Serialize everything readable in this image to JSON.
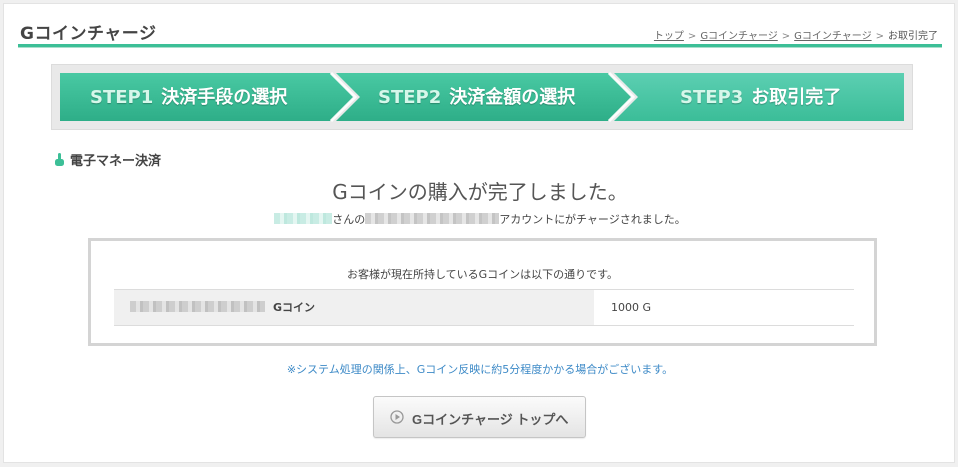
{
  "header": {
    "title": "Gコインチャージ",
    "breadcrumb": [
      {
        "label": "トップ",
        "link": true
      },
      {
        "label": "Gコインチャージ",
        "link": true
      },
      {
        "label": "Gコインチャージ",
        "link": true
      },
      {
        "label": "お取引完了",
        "link": false
      }
    ],
    "breadcrumb_separator": ">"
  },
  "steps": [
    {
      "num": "STEP1",
      "label": "決済手段の選択"
    },
    {
      "num": "STEP2",
      "label": "決済金額の選択"
    },
    {
      "num": "STEP3",
      "label": "お取引完了"
    }
  ],
  "section": {
    "heading": "電子マネー決済"
  },
  "result": {
    "title": "Gコインの購入が完了しました。",
    "account_suffix_1": "さんの",
    "account_suffix_2": "アカウントにがチャージされました。"
  },
  "balance": {
    "caption": "お客様が現在所持しているGコインは以下の通りです。",
    "row_label": "Gコイン",
    "row_value": "1000 G"
  },
  "notice": "※システム処理の関係上、Gコイン反映に約5分程度かかる場合がございます。",
  "button": {
    "label": "Gコインチャージ トップへ"
  },
  "colors": {
    "accent": "#3cbf97",
    "step_dark": "#2fb08a",
    "step_light": "#6ad7bd",
    "notice": "#3d8ac7"
  },
  "icons": {
    "section": "finger-pointer-icon",
    "button": "play-circle-icon"
  }
}
